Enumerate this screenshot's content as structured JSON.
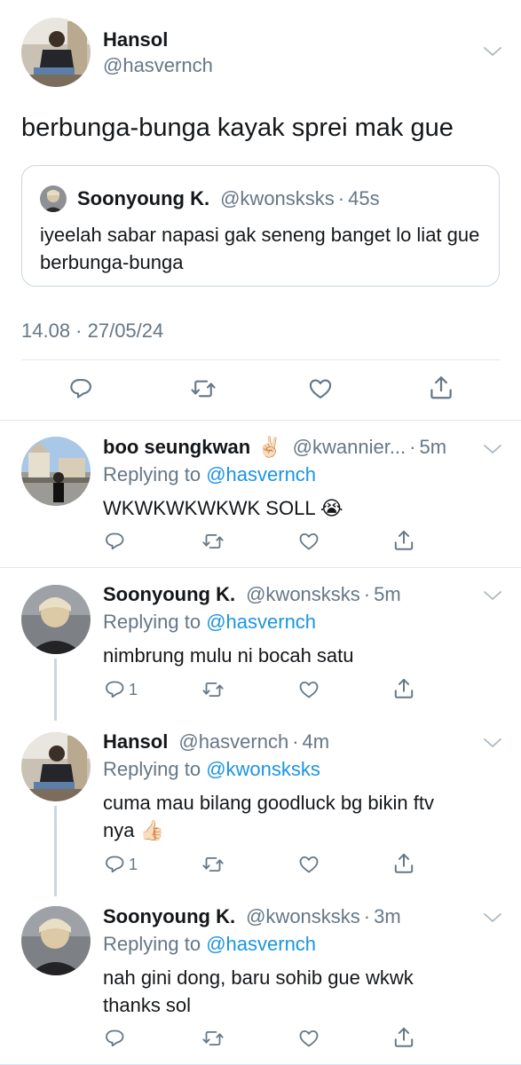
{
  "main_tweet": {
    "name": "Hansol",
    "handle": "@hasvernch",
    "text": "berbunga-bunga kayak sprei mak gue",
    "quote": {
      "name": "Soonyoung K.",
      "handle": "@kwonsksks",
      "time": "45s",
      "text": "iyeelah sabar napasi gak seneng banget lo liat gue berbunga-bunga"
    },
    "timestamp": "14.08 · 27/05/24",
    "actions": [
      "reply-icon",
      "retweet-icon",
      "like-icon",
      "share-icon"
    ]
  },
  "replies": [
    {
      "name": "boo seungkwan",
      "name_emoji": "✌🏻",
      "handle": "@kwannier...",
      "time": "5m",
      "replying_prefix": "Replying to",
      "replying_to": "@hasvernch",
      "text": "WKWKWKWKWK SOLL",
      "text_emoji": "😭",
      "reply_count": ""
    },
    {
      "name": "Soonyoung K.",
      "handle": "@kwonsksks",
      "time": "5m",
      "replying_prefix": "Replying to",
      "replying_to": "@hasvernch",
      "text": "nimbrung mulu ni bocah satu",
      "reply_count": "1"
    },
    {
      "name": "Hansol",
      "handle": "@hasvernch",
      "time": "4m",
      "replying_prefix": "Replying to",
      "replying_to": "@kwonsksks",
      "text_line1": "cuma mau bilang goodluck bg bikin ftv",
      "text_line2": "nya",
      "text_emoji": "👍🏻",
      "reply_count": "1"
    },
    {
      "name": "Soonyoung K.",
      "handle": "@kwonsksks",
      "time": "3m",
      "replying_prefix": "Replying to",
      "replying_to": "@hasvernch",
      "text_line1": "nah gini dong, baru sohib gue wkwk",
      "text_line2": "thanks sol",
      "reply_count": ""
    }
  ],
  "colors": {
    "accent": "#1b95e0",
    "secondary_text": "#657786",
    "divider": "#e1e8ed"
  }
}
